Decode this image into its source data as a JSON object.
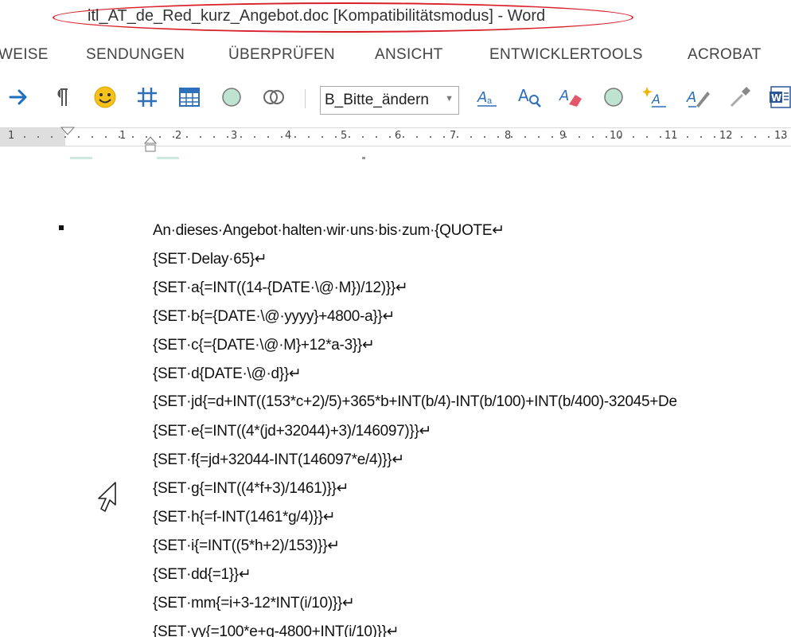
{
  "window": {
    "title": "itl_AT_de_Red_kurz_Angebot.doc [Kompatibilitätsmodus] - Word"
  },
  "ribbon": {
    "tabs": [
      "WEISE",
      "SENDUNGEN",
      "ÜBERPRÜFEN",
      "ANSICHT",
      "ENTWICKLERTOOLS",
      "ACROBAT"
    ]
  },
  "toolbar": {
    "style_value": "B_Bitte_ändern",
    "icons": [
      "arrow-right-icon",
      "pilcrow-icon",
      "smiley-icon",
      "grid-hash-icon",
      "table-icon",
      "green-circle-icon",
      "interlocking-circles-icon",
      "text-style-icon",
      "find-format-icon",
      "eraser-icon",
      "green-dot-icon",
      "sparkle-format-icon",
      "pen-format-icon",
      "dropper-icon",
      "word-icon"
    ]
  },
  "ruler": {
    "numbers": [
      "1",
      "1",
      "2",
      "3",
      "4",
      "5",
      "6",
      "7",
      "8",
      "9",
      "10",
      "11",
      "12",
      "13"
    ]
  },
  "document": {
    "lines": [
      "An·dieses·Angebot·halten·wir·uns·bis·zum·{QUOTE↵",
      "{SET·Delay·65}↵",
      "{SET·a{=INT((14-{DATE·\\@·M})/12)}}↵",
      "{SET·b{={DATE·\\@·yyyy}+4800-a}}↵",
      "{SET·c{={DATE·\\@·M}+12*a-3}}↵",
      "{SET·d{DATE·\\@·d}}↵",
      "{SET·jd{=d+INT((153*c+2)/5)+365*b+INT(b/4)-INT(b/100)+INT(b/400)-32045+De",
      "{SET·e{=INT((4*(jd+32044)+3)/146097)}}↵",
      "{SET·f{=jd+32044-INT(146097*e/4)}}↵",
      "{SET·g{=INT((4*f+3)/1461)}}↵",
      "{SET·h{=f-INT(1461*g/4)}}↵",
      "{SET·i{=INT((5*h+2)/153)}}↵",
      "{SET·dd{=1}}↵",
      "{SET·mm{=i+3-12*INT(i/10)}}↵",
      "{SET·yy{=100*e+g-4800+INT(i/10)}}↵"
    ]
  },
  "colors": {
    "title_highlight": "#d8202a",
    "arrow_blue": "#1e6fc0",
    "smiley_yellow": "#f6c21a",
    "ruler_bg": "#f3f3f3"
  }
}
